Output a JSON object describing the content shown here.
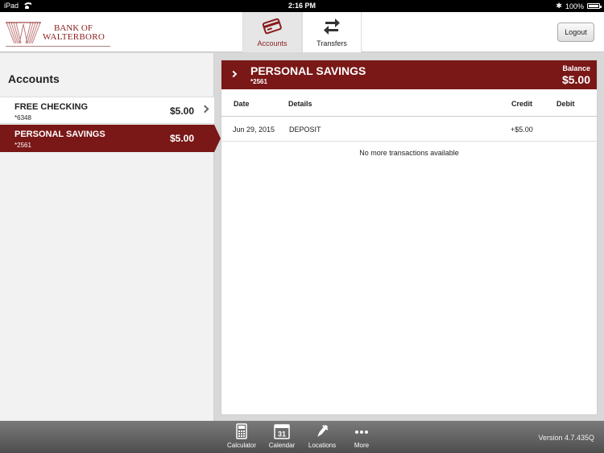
{
  "status_bar": {
    "device": "iPad",
    "time": "2:16 PM",
    "battery": "100%"
  },
  "header": {
    "logo_line1": "BANK OF",
    "logo_line2": "WALTERBORO",
    "tabs": [
      {
        "label": "Accounts",
        "icon": "credit-card-icon",
        "active": true
      },
      {
        "label": "Transfers",
        "icon": "transfer-arrows-icon",
        "active": false
      }
    ],
    "logout_label": "Logout"
  },
  "accounts_panel": {
    "title": "Accounts",
    "items": [
      {
        "name": "FREE CHECKING",
        "number": "*6348",
        "balance": "$5.00",
        "selected": false
      },
      {
        "name": "PERSONAL SAVINGS",
        "number": "*2561",
        "balance": "$5.00",
        "selected": true
      }
    ]
  },
  "detail": {
    "title": "PERSONAL SAVINGS",
    "number": "*2561",
    "balance_label": "Balance",
    "balance_value": "$5.00",
    "columns": {
      "date": "Date",
      "details": "Details",
      "credit": "Credit",
      "debit": "Debit"
    },
    "transactions": [
      {
        "date": "Jun 29, 2015",
        "details": "DEPOSIT",
        "credit": "+$5.00",
        "debit": ""
      }
    ],
    "empty_message": "No more transactions available"
  },
  "toolbar": {
    "items": [
      {
        "label": "Calculator",
        "icon": "calculator-icon"
      },
      {
        "label": "Calendar",
        "icon": "calendar-icon",
        "day": "31"
      },
      {
        "label": "Locations",
        "icon": "map-pin-icon"
      },
      {
        "label": "More",
        "icon": "more-dots-icon"
      }
    ],
    "version": "Version 4.7.435Q"
  },
  "colors": {
    "brand": "#7a1717",
    "toolbar": "#5c5c5c"
  }
}
